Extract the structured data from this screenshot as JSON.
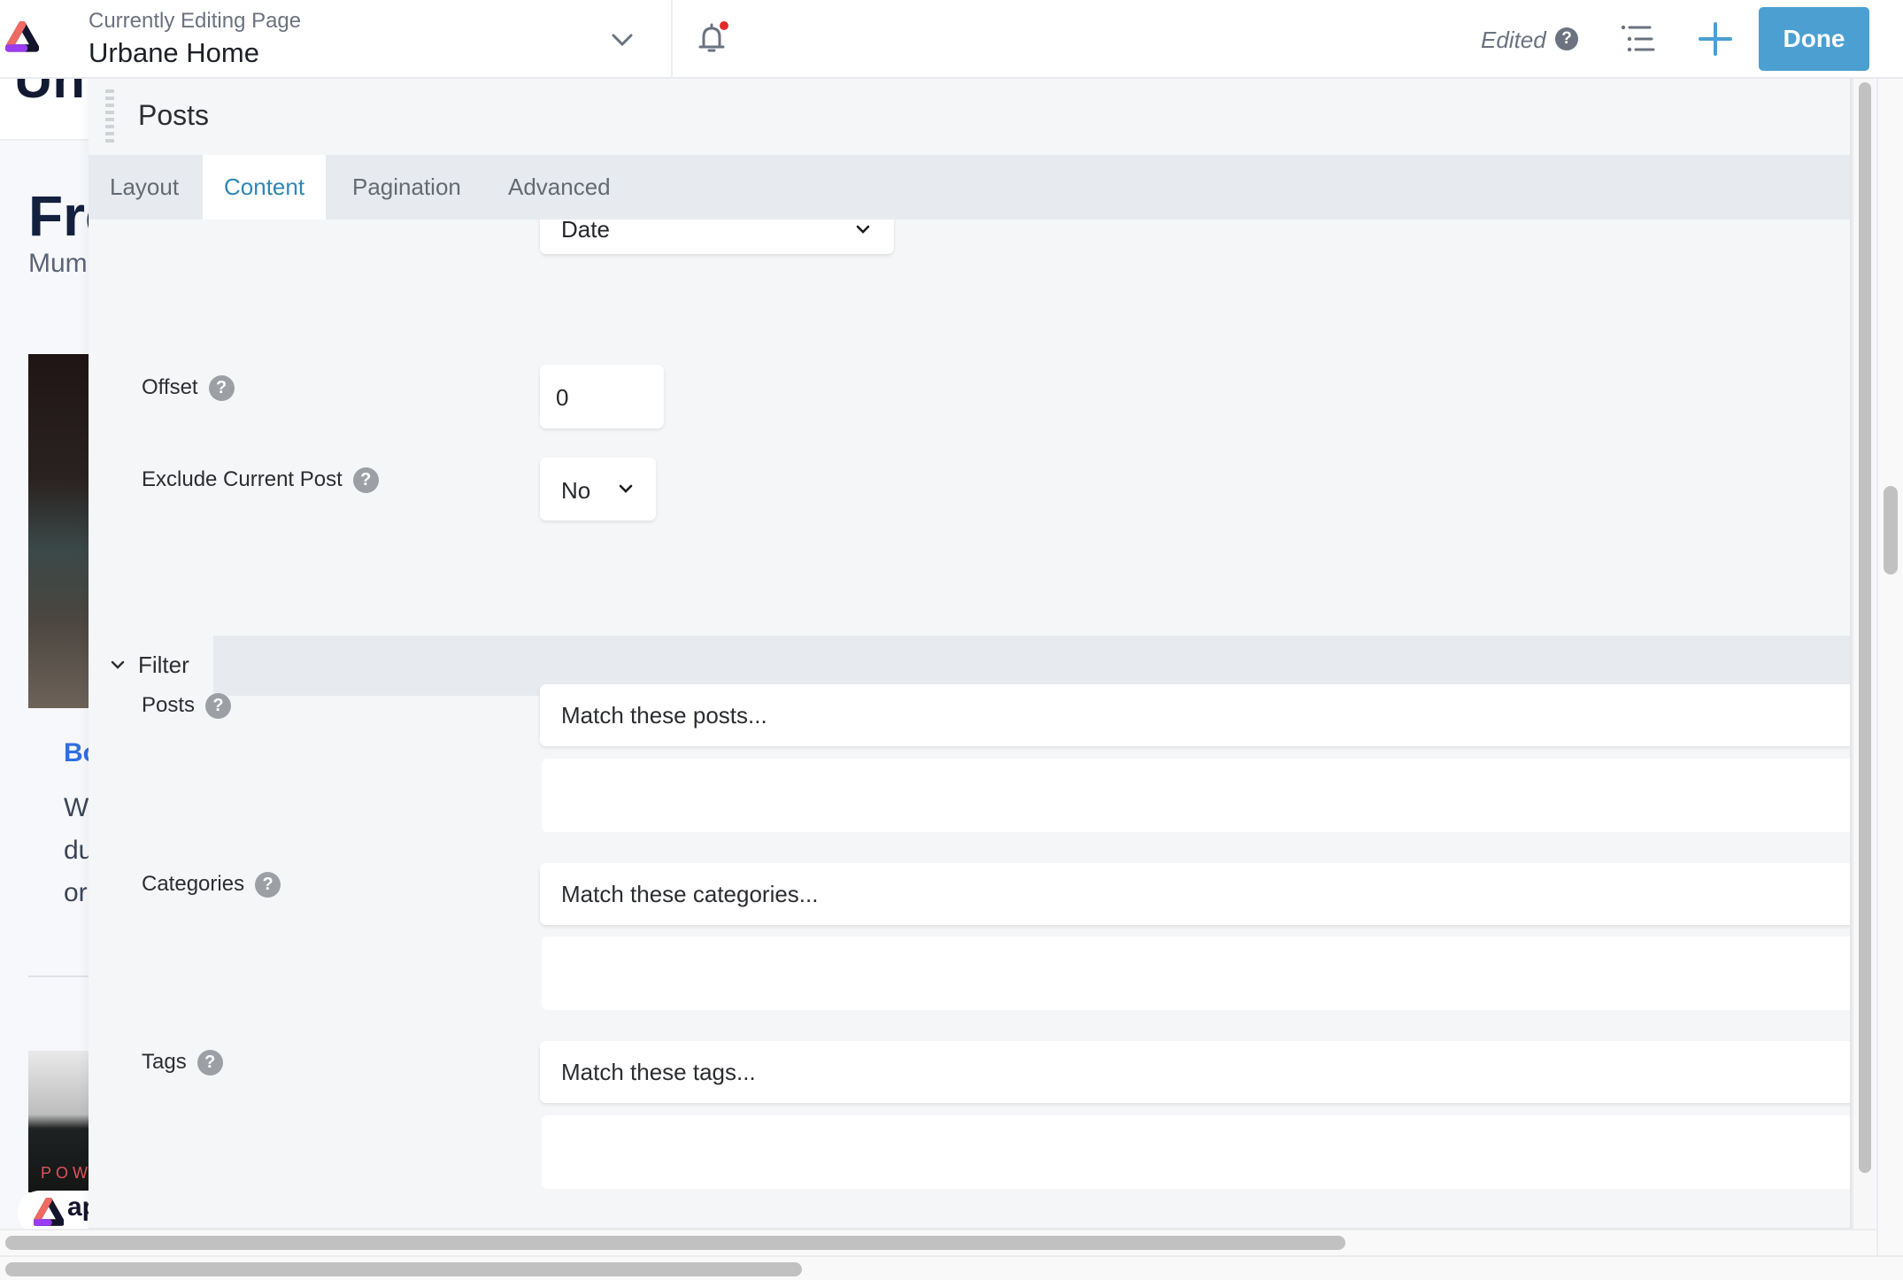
{
  "topbar": {
    "editing_label": "Currently Editing Page",
    "page_name": "Urbane Home",
    "status": "Edited",
    "help_glyph": "?",
    "done_label": "Done",
    "icons": [
      "logo-icon",
      "chevron-down-icon",
      "bell-icon",
      "outline-list-icon",
      "plus-icon"
    ],
    "notification_dot_color": "#e02b2b",
    "accent_color": "#4b9fd1"
  },
  "background_page": {
    "top_fragment": "Un",
    "heading_fragment": "Fre",
    "subtitle_fragment": "Mum",
    "link_fragment": "Bo",
    "paragraph_fragments": [
      "W",
      "du",
      "or"
    ],
    "image_caption_fragment": "POW",
    "badge_text_fragment": "ap"
  },
  "panel": {
    "title": "Posts",
    "tabs": [
      {
        "label": "Layout",
        "active": false
      },
      {
        "label": "Content",
        "active": true
      },
      {
        "label": "Pagination",
        "active": false
      },
      {
        "label": "Advanced",
        "active": false
      }
    ],
    "fields": {
      "order_by": {
        "value": "Date"
      },
      "offset": {
        "label": "Offset",
        "value": "0"
      },
      "exclude_current_post": {
        "label": "Exclude Current Post",
        "value": "No"
      }
    },
    "filter_section": {
      "label": "Filter",
      "expanded": true,
      "rows": [
        {
          "label": "Posts",
          "placeholder": "Match these posts..."
        },
        {
          "label": "Categories",
          "placeholder": "Match these categories..."
        },
        {
          "label": "Tags",
          "placeholder": "Match these tags..."
        }
      ]
    },
    "help_glyph": "?"
  }
}
